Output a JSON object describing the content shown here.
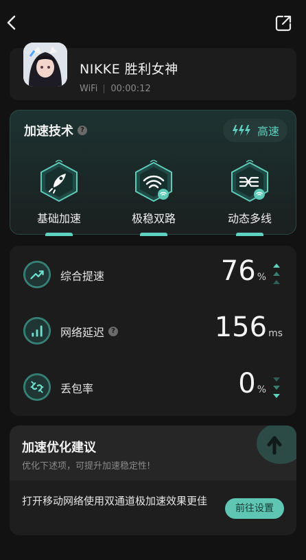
{
  "game": {
    "name": "NIKKE 胜利女神",
    "network": "WiFi",
    "duration": "00:00:12"
  },
  "tech": {
    "title": "加速技术",
    "mode": "高速",
    "items": [
      {
        "label": "基础加速",
        "icon": "rocket-icon"
      },
      {
        "label": "极稳双路",
        "icon": "wifi-dual-icon"
      },
      {
        "label": "动态多线",
        "icon": "multi-line-icon"
      }
    ]
  },
  "stats": {
    "speedup": {
      "label": "综合提速",
      "value": "76",
      "unit": "%",
      "trend": "up"
    },
    "latency": {
      "label": "网络延迟",
      "value": "156",
      "unit": "ms"
    },
    "loss": {
      "label": "丢包率",
      "value": "0",
      "unit": "%",
      "trend": "down"
    }
  },
  "suggest": {
    "title": "加速优化建议",
    "subtitle": "优化下述项，可提升加速稳定性!",
    "tip": "打开移动网络使用双通道极加速效果更佳",
    "button": "前往设置"
  },
  "colors": {
    "accent": "#5ec6b3",
    "background": "#121212",
    "card": "#1c1c1c"
  }
}
